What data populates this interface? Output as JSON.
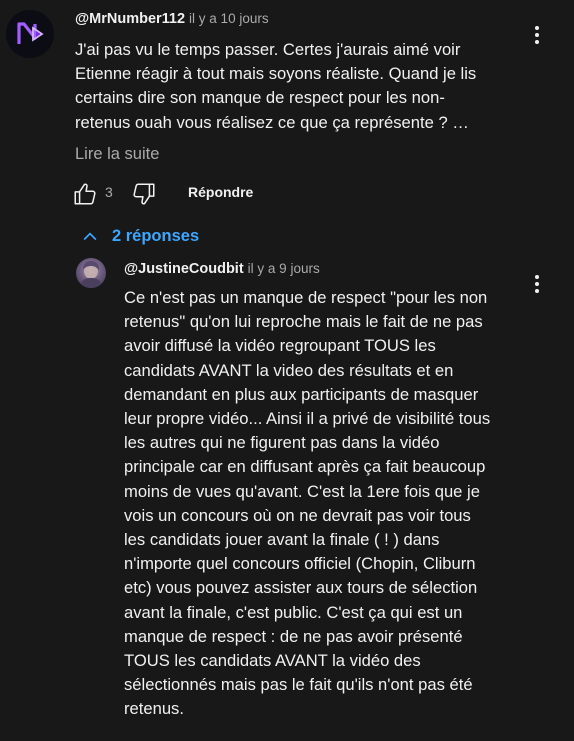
{
  "comment": {
    "author": "@MrNumber112",
    "time": "il y a 10 jours",
    "text_lines": [
      "J'ai pas vu le temps passer. Certes j'aurais aimé voir",
      "Etienne réagir à tout mais soyons réaliste. Quand je lis",
      "certains dire son manque de respect pour les non-",
      "retenus ouah vous réalisez ce que ça représente ? …"
    ],
    "read_more": "Lire la suite",
    "like_count": "3",
    "reply_label": "Répondre",
    "avatar_icon": "n-logo-avatar",
    "avatar_accent": "#8b3cff"
  },
  "replies": {
    "toggle_label": "2 réponses",
    "toggle_icon": "chevron-up-icon",
    "accent": "#3ea6ff"
  },
  "reply": {
    "author": "@JustineCoudbit",
    "time": "il y a 9 jours",
    "text_lines": [
      "Ce n'est pas un manque de respect \"pour les non",
      "retenus\" qu'on lui reproche mais le fait de ne pas",
      "avoir diffusé la vidéo regroupant TOUS les",
      "candidats AVANT la video des résultats et en",
      "demandant en plus aux participants de masquer",
      "leur propre vidéo... Ainsi il a privé de visibilité tous",
      "les autres qui ne figurent pas dans la vidéo",
      "principale car en diffusant après ça fait beaucoup",
      "moins de vues qu'avant.  C'est la 1ere fois que je",
      "vois un concours où on ne devrait pas voir tous",
      "les candidats jouer avant la finale ( ! ) dans",
      "n'importe quel concours officiel (Chopin, Cliburn",
      "etc) vous pouvez assister aux tours de sélection",
      "avant la finale, c'est public. C'est ça qui est un",
      "manque de respect : de ne pas avoir présenté",
      "TOUS les candidats AVANT la vidéo des",
      "sélectionnés mais pas le fait qu'ils n'ont pas été",
      "retenus."
    ]
  }
}
